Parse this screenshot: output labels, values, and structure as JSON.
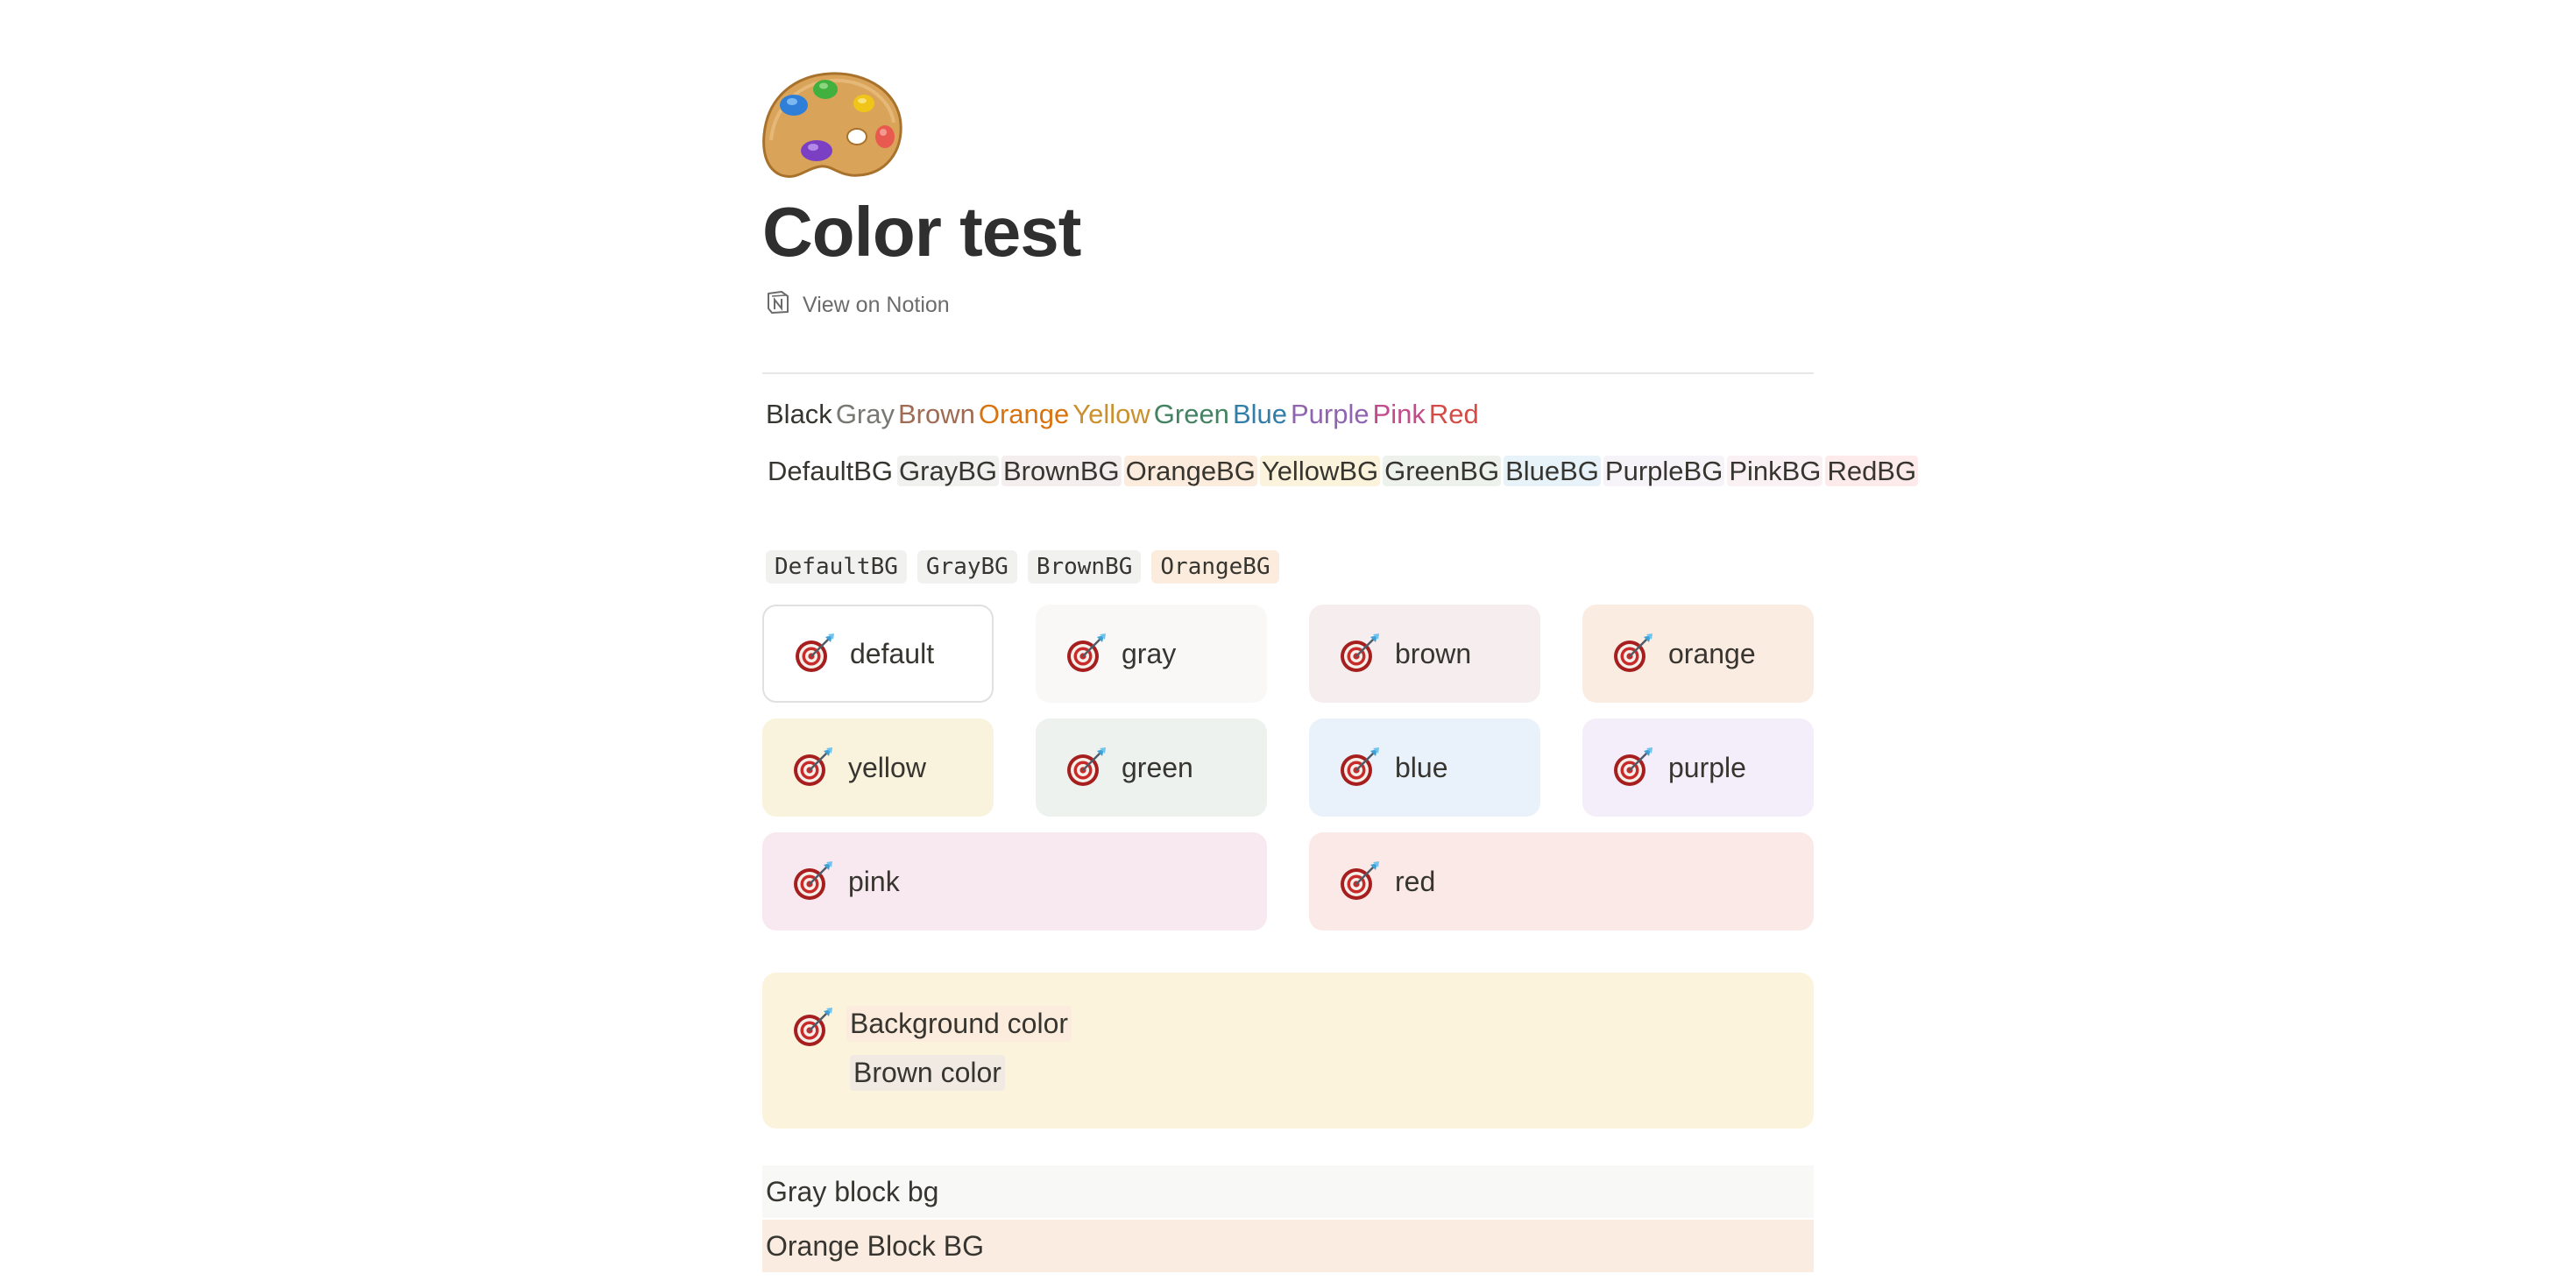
{
  "page": {
    "title": "Color test",
    "page_icon": "artist-palette-icon",
    "view_link": "View on Notion",
    "view_link_icon": "notion-logo-icon"
  },
  "text_colors": [
    {
      "label": "Black",
      "color": "#37352f"
    },
    {
      "label": "Gray",
      "color": "#787774"
    },
    {
      "label": "Brown",
      "color": "#9f6b53"
    },
    {
      "label": "Orange",
      "color": "#d9730d"
    },
    {
      "label": "Yellow",
      "color": "#cb912f"
    },
    {
      "label": "Green",
      "color": "#448361"
    },
    {
      "label": "Blue",
      "color": "#337ea9"
    },
    {
      "label": "Purple",
      "color": "#9065b0"
    },
    {
      "label": "Pink",
      "color": "#c14c8a"
    },
    {
      "label": "Red",
      "color": "#d44c47"
    }
  ],
  "bg_colors": [
    {
      "label": "DefaultBG",
      "bg": "transparent"
    },
    {
      "label": "GrayBG",
      "bg": "#f1f1ef"
    },
    {
      "label": "BrownBG",
      "bg": "#f4eeee"
    },
    {
      "label": "OrangeBG",
      "bg": "#fbecdd"
    },
    {
      "label": "YellowBG",
      "bg": "#fbf3db"
    },
    {
      "label": "GreenBG",
      "bg": "#edf3ec"
    },
    {
      "label": "BlueBG",
      "bg": "#e7f3f8"
    },
    {
      "label": "PurpleBG",
      "bg": "#f6f3f9"
    },
    {
      "label": "PinkBG",
      "bg": "#faf1f5"
    },
    {
      "label": "RedBG",
      "bg": "#fdebec"
    }
  ],
  "code_tags": [
    {
      "label": "DefaultBG",
      "bg": "#f1f1ef"
    },
    {
      "label": "GrayBG",
      "bg": "#f1f1ef"
    },
    {
      "label": "BrownBG",
      "bg": "#f1f1ef"
    },
    {
      "label": "OrangeBG",
      "bg": "#fbecdd"
    }
  ],
  "callouts": [
    {
      "label": "default",
      "bg": "#ffffff",
      "icon": "direct-hit-target-icon"
    },
    {
      "label": "gray",
      "bg": "#f9f8f7",
      "icon": "direct-hit-target-icon"
    },
    {
      "label": "brown",
      "bg": "#f6eeee",
      "icon": "direct-hit-target-icon"
    },
    {
      "label": "orange",
      "bg": "#fbece2",
      "icon": "direct-hit-target-icon"
    },
    {
      "label": "yellow",
      "bg": "#f9f3de",
      "icon": "direct-hit-target-icon"
    },
    {
      "label": "green",
      "bg": "#edf2ee",
      "icon": "direct-hit-target-icon"
    },
    {
      "label": "blue",
      "bg": "#e9f2fb",
      "icon": "direct-hit-target-icon"
    },
    {
      "label": "purple",
      "bg": "#f3eefa",
      "icon": "direct-hit-target-icon"
    },
    {
      "label": "pink",
      "bg": "#f8e8ef",
      "icon": "direct-hit-target-icon"
    },
    {
      "label": "red",
      "bg": "#fae9e7",
      "icon": "direct-hit-target-icon"
    }
  ],
  "big_callout": {
    "icon": "direct-hit-target-icon",
    "line1": "Background color",
    "line2": "Brown color"
  },
  "blocks": [
    {
      "label": "Gray block bg",
      "bg": "#f8f8f7"
    },
    {
      "label": "Orange Block BG",
      "bg": "#fbece2"
    }
  ]
}
